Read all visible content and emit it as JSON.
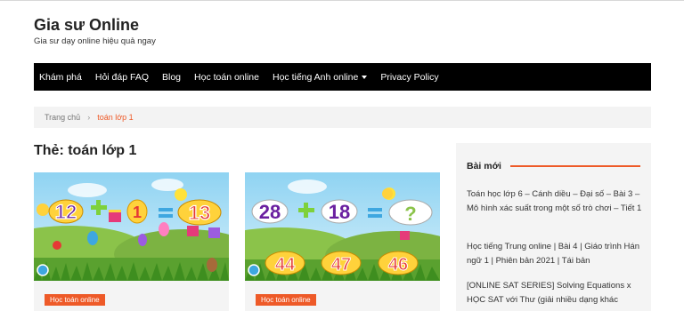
{
  "site": {
    "title": "Gia sư Online",
    "description": "Gia sư dạy online hiệu quả ngay"
  },
  "nav": {
    "items": [
      {
        "label": "Khám phá"
      },
      {
        "label": "Hỏi đáp FAQ"
      },
      {
        "label": "Blog"
      },
      {
        "label": "Học toán online"
      },
      {
        "label": "Học tiếng Anh online"
      },
      {
        "label": "Privacy Policy"
      }
    ]
  },
  "breadcrumb": {
    "home": "Trang chủ",
    "separator": "›",
    "current": "toán lớp 1"
  },
  "archive": {
    "title": "Thẻ: toán lớp 1"
  },
  "posts": [
    {
      "category": "Học toán online",
      "thumbnail": {
        "a": "12",
        "b": "1",
        "result": "13",
        "answers": []
      }
    },
    {
      "category": "Học toán online",
      "thumbnail": {
        "a": "28",
        "b": "18",
        "result": "?",
        "answers": [
          "44",
          "47",
          "46"
        ]
      }
    }
  ],
  "sidebar": {
    "widget_title": "Bài mới",
    "recent_posts": [
      "Toán học lớp 6 – Cánh diều – Đại số – Bài 3 – Mô hình xác suất trong một số trò chơi – Tiết 1",
      "Học tiếng Trung online | Bài 4 | Giáo trình Hán ngữ 1 | Phiên bản 2021 | Tái bản",
      "[ONLINE SAT SERIES] Solving Equations x HỌC SAT với Thư (giải nhiều dạng khác"
    ]
  },
  "colors": {
    "accent": "#ee5a28",
    "nav_bg": "#000000",
    "panel_bg": "#f4f4f4"
  }
}
